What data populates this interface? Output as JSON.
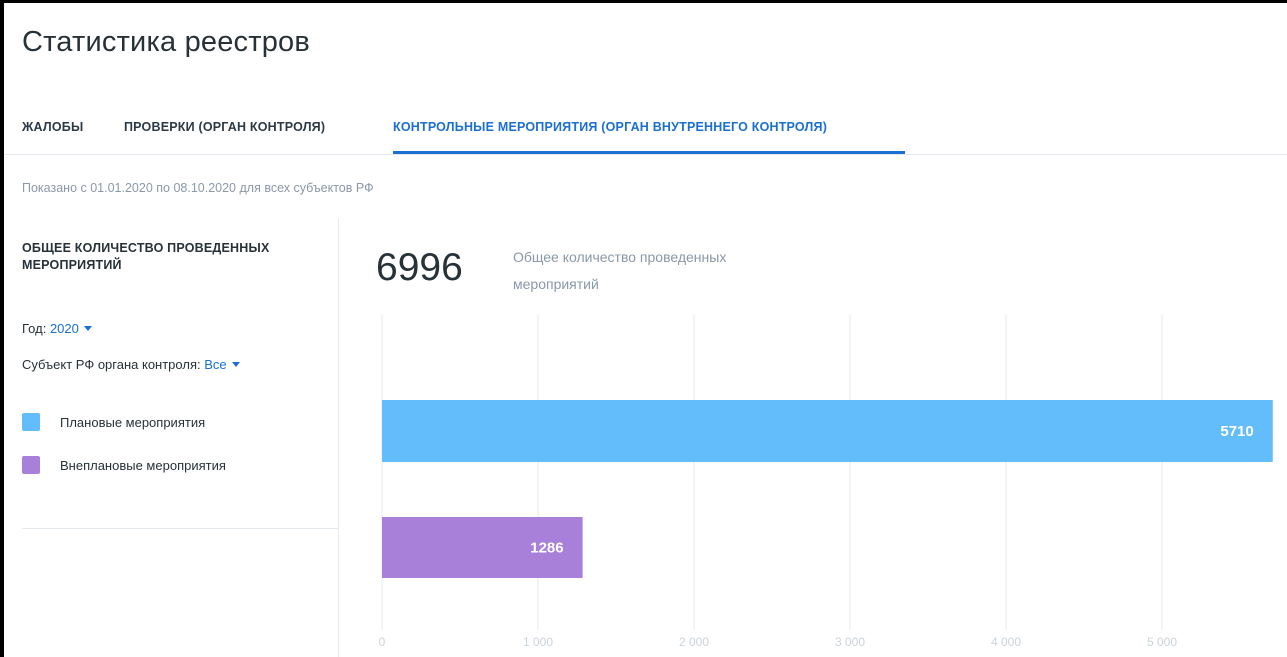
{
  "page": {
    "title": "Статистика реестров"
  },
  "tabs": [
    {
      "label": "ЖАЛОБЫ",
      "active": false
    },
    {
      "label": "ПРОВЕРКИ (ОРГАН КОНТРОЛЯ)",
      "active": false
    },
    {
      "label": "КОНТРОЛЬНЫЕ МЕРОПРИЯТИЯ (ОРГАН ВНУТРЕННЕГО КОНТРОЛЯ)",
      "active": true
    }
  ],
  "period_text": "Показано с 01.01.2020 по 08.10.2020 для всех субъектов РФ",
  "sidebar": {
    "section_title": "ОБЩЕЕ КОЛИЧЕСТВО ПРОВЕДЕННЫХ МЕРОПРИЯТИЙ",
    "year_filter": {
      "label": "Год:",
      "value": "2020"
    },
    "subject_filter": {
      "label": "Субъект РФ органа контроля:",
      "value": "Все"
    },
    "legend": [
      {
        "label": "Плановые мероприятия",
        "color": "#64bdfb"
      },
      {
        "label": "Внеплановые мероприятия",
        "color": "#a880d9"
      }
    ]
  },
  "summary": {
    "total": "6996",
    "label": "Общее количество проведенных мероприятий"
  },
  "colors": {
    "accent": "#1a6fd1",
    "planned": "#64bdfb",
    "unplanned": "#a880d9",
    "grid": "#eef1f4"
  },
  "chart_data": {
    "type": "bar",
    "orientation": "horizontal",
    "categories": [
      "Плановые мероприятия",
      "Внеплановые мероприятия"
    ],
    "values": [
      5710,
      1286
    ],
    "colors": [
      "#64bdfb",
      "#a880d9"
    ],
    "xlim": [
      0,
      5700
    ],
    "x_ticks": [
      0,
      1000,
      2000,
      3000,
      4000,
      5000
    ],
    "x_tick_labels": [
      "0",
      "1 000",
      "2 000",
      "3 000",
      "4 000",
      "5 000"
    ],
    "grid": true
  }
}
